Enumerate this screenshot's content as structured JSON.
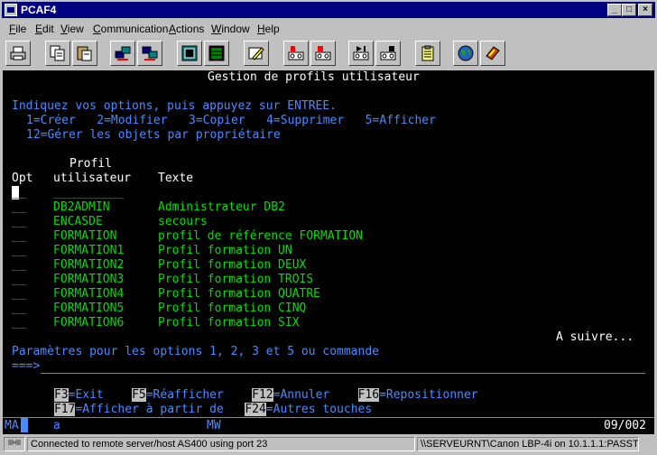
{
  "window": {
    "title": "PCAF4",
    "minimize": "_",
    "maximize": "□",
    "close": "×"
  },
  "menu": {
    "file": "File",
    "edit": "Edit",
    "view": "View",
    "communication": "Communication",
    "actions": "Actions",
    "window": "Window",
    "help": "Help"
  },
  "toolbar": {
    "buttons": [
      "print-icon",
      "copy-icon",
      "paste-icon",
      "send-file-icon",
      "receive-file-icon",
      "display-icon",
      "macro-icon",
      "edit-icon",
      "record-macro-icon",
      "stop-macro-icon",
      "play-macro-icon",
      "pause-macro-icon",
      "clipboard-icon",
      "globe-icon",
      "help-book-icon"
    ]
  },
  "terminal": {
    "heading": "Gestion de profils utilisateur",
    "instructions": "Indiquez vos options, puis appuyez sur ENTREE.",
    "options_line1": "1=Créer   2=Modifier   3=Copier   4=Supprimer   5=Afficher",
    "options_line2": "12=Gérer les objets par propriétaire",
    "col_profil_top": "Profil",
    "col_opt": "Opt",
    "col_profil_bottom": "utilisateur",
    "col_texte": "Texte",
    "input_underline": "__",
    "profile_underline": "__________",
    "rows": [
      {
        "opt": "__",
        "profile": "DB2ADMIN",
        "text": "Administrateur DB2"
      },
      {
        "opt": "__",
        "profile": "ENCASDE",
        "text": "secours"
      },
      {
        "opt": "__",
        "profile": "FORMATION",
        "text": "profil de référence FORMATION"
      },
      {
        "opt": "__",
        "profile": "FORMATION1",
        "text": "Profil formation UN"
      },
      {
        "opt": "__",
        "profile": "FORMATION2",
        "text": "Profil formation DEUX"
      },
      {
        "opt": "__",
        "profile": "FORMATION3",
        "text": "Profil formation TROIS"
      },
      {
        "opt": "__",
        "profile": "FORMATION4",
        "text": "Profil formation QUATRE"
      },
      {
        "opt": "__",
        "profile": "FORMATION5",
        "text": "Profil formation CINQ"
      },
      {
        "opt": "__",
        "profile": "FORMATION6",
        "text": "Profil formation SIX"
      }
    ],
    "more": "A suivre...",
    "params_label": "Paramètres pour les options 1, 2, 3 et 5 ou commande",
    "prompt": "===>",
    "fkeys_line1": [
      {
        "key": "F3",
        "label": "=Exit"
      },
      {
        "key": "F5",
        "label": "=Réafficher"
      },
      {
        "key": "F12",
        "label": "=Annuler"
      },
      {
        "key": "F16",
        "label": "=Repositionner"
      }
    ],
    "fkeys_line2": [
      {
        "key": "F17",
        "label": "=Afficher à partir de"
      },
      {
        "key": "F24",
        "label": "=Autres touches"
      }
    ]
  },
  "oia": {
    "ma": "MA",
    "a": "a",
    "mw": "MW",
    "position": "09/002"
  },
  "status": {
    "connection": "Connected to remote server/host AS400 using port 23",
    "printer": "\\\\SERVEURNT\\Canon LBP-4i on 10.1.1.1:PASST"
  }
}
